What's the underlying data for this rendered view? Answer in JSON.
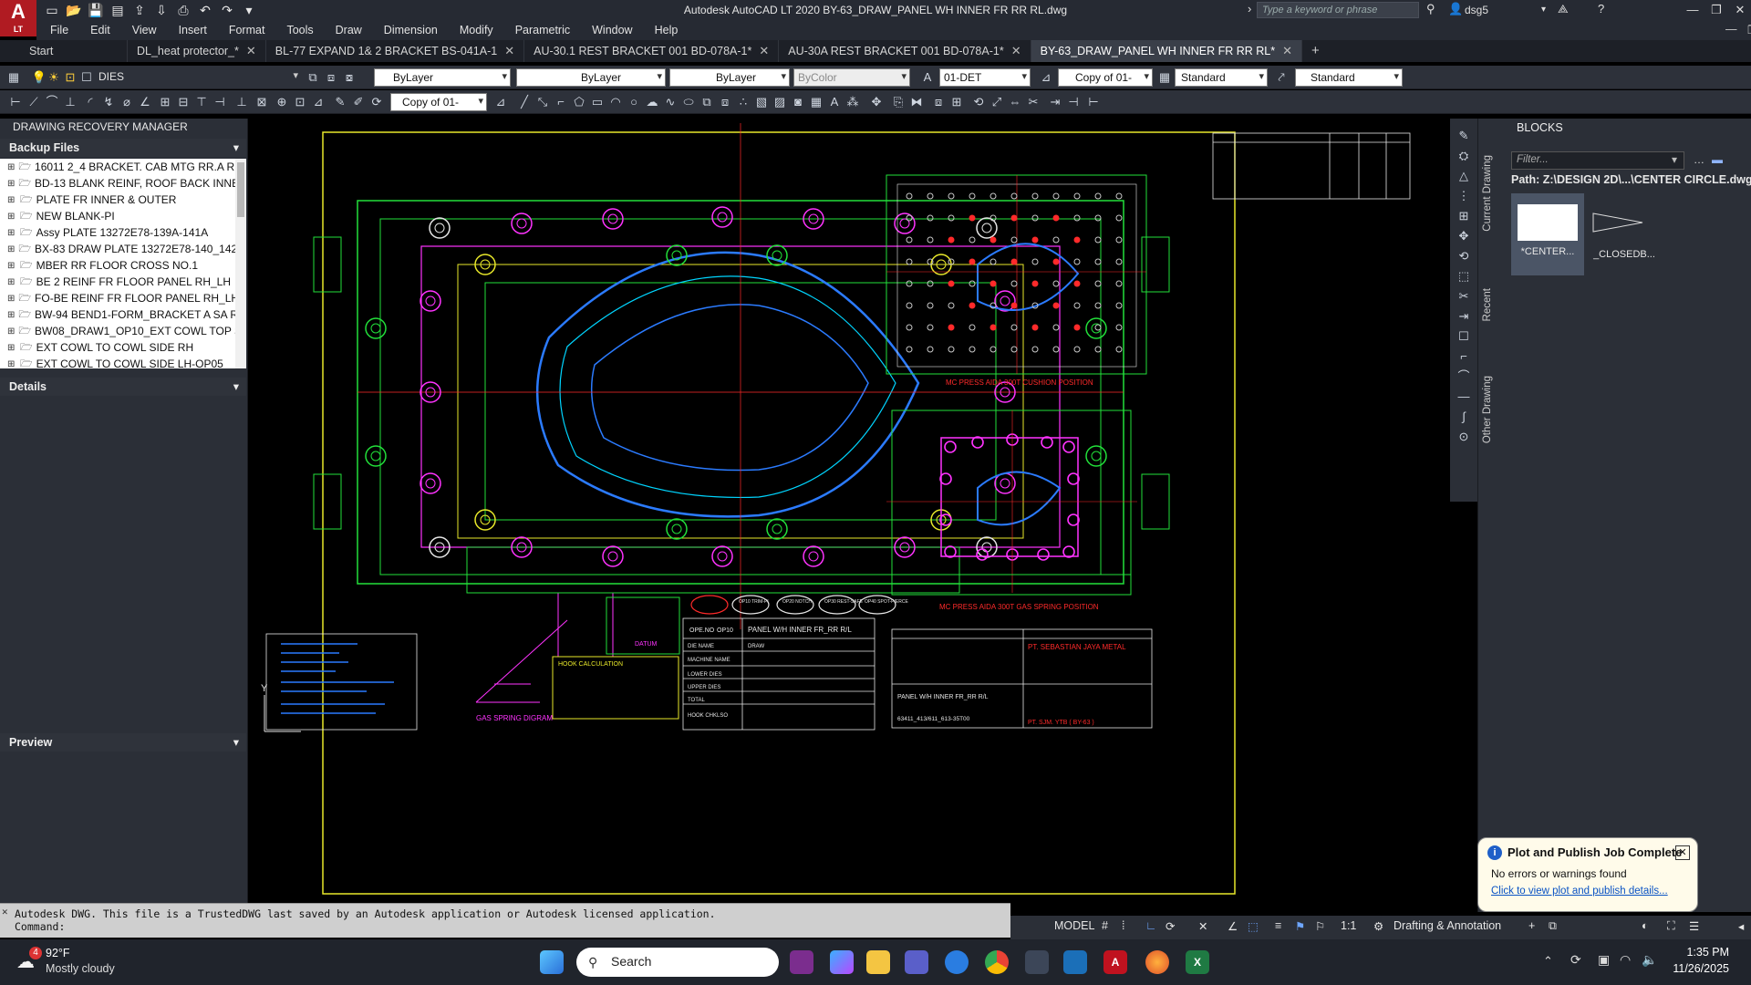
{
  "window": {
    "title": "Autodesk AutoCAD LT 2020   BY-63_DRAW_PANEL WH INNER FR RR RL.dwg",
    "search_placeholder": "Type a keyword or phrase",
    "user": "dsg5",
    "logo_letter": "A",
    "logo_sub": "LT"
  },
  "menu": [
    "File",
    "Edit",
    "View",
    "Insert",
    "Format",
    "Tools",
    "Draw",
    "Dimension",
    "Modify",
    "Parametric",
    "Window",
    "Help"
  ],
  "tabs": [
    {
      "label": "Start",
      "closable": false,
      "active": false
    },
    {
      "label": "DL_heat protector_*",
      "closable": true,
      "active": false
    },
    {
      "label": "BL-77 EXPAND 1& 2 BRACKET BS-041A-1",
      "closable": true,
      "active": false
    },
    {
      "label": "AU-30.1 REST BRACKET 001 BD-078A-1*",
      "closable": true,
      "active": false
    },
    {
      "label": "AU-30A REST BRACKET 001 BD-078A-1*",
      "closable": true,
      "active": false
    },
    {
      "label": "BY-63_DRAW_PANEL WH INNER FR RR RL*",
      "closable": true,
      "active": true
    }
  ],
  "properties_bar": {
    "layer": "DIES",
    "color": "ByLayer",
    "linetype": "ByLayer",
    "lineweight": "ByLayer",
    "plotstyle": "ByColor",
    "dimstyle": "01-DET",
    "text_style": "Copy of 01-",
    "table_style": "Standard",
    "mleader_style": "Standard",
    "dim_override": "Copy of 01-"
  },
  "left_panel": {
    "title": "DRAWING RECOVERY MANAGER",
    "backup_header": "Backup Files",
    "details_header": "Details",
    "preview_header": "Preview",
    "backup_files": [
      "16011 2_4 BRACKET. CAB MTG RR.A RH",
      "BD-13 BLANK REINF, ROOF BACK INNE",
      "PLATE FR INNER & OUTER",
      "NEW BLANK-PI",
      "Assy PLATE 13272E78-139A-141A",
      "BX-83 DRAW PLATE 13272E78-140_142",
      "MBER RR FLOOR CROSS NO.1",
      "BE 2 REINF FR FLOOR PANEL RH_LH",
      "FO-BE REINF FR FLOOR PANEL RH_LH",
      "BW-94 BEND1-FORM_BRACKET A SA RI",
      "BW08_DRAW1_OP10_EXT COWL TOP SI",
      "EXT COWL TO COWL SIDE RH",
      "EXT COWL TO COWL SIDE LH-OP05"
    ]
  },
  "blocks_panel": {
    "title": "BLOCKS",
    "filter_placeholder": "Filter...",
    "path": "Path: Z:\\DESIGN 2D\\...\\CENTER CIRCLE.dwg",
    "vtabs": [
      "Current Drawing",
      "Recent",
      "Other Drawing"
    ],
    "items": [
      "*CENTER...",
      "_CLOSEDB..."
    ]
  },
  "drawing": {
    "title_block": {
      "ope_no": "OPE.NO",
      "op": "OP10",
      "part_name": "PANEL W/H INNER FR_RR R/L",
      "die_name_label": "DIE NAME",
      "die_name": "DRAW",
      "machine_name_label": "MACHINE NAME",
      "upper_dies_label": "UPPER DIES",
      "lower_dies_label": "LOWER DIES",
      "total_label": "TOTAL",
      "hook_label": "HOOK CHKLSO",
      "company": "PT. SEBASTIAN JAYA METAL",
      "part_name_footer": "PANEL W/H INNER FR_RR R/L",
      "part_no": "63411_413/611_613-35T00",
      "ref": "PT. SJM. YTB ( BY-63 )"
    },
    "press_cushion_label": "MC PRESS AIDA 300T CUSHION POSITION",
    "press_gas_label": "MC PRESS AIDA 300T GAS SPRING POSITION",
    "ops": [
      "OP10 TRIM-PI",
      "OP20 NOTCH",
      "OP30 REST-SAFE",
      "OP40 SPOT-PIERCE"
    ],
    "gas_spring_label": "GAS SPRING DIGRAM",
    "hook_calc_title": "HOOK CALCULATION",
    "datum_label": "DATUM"
  },
  "command": {
    "history": "Autodesk DWG.  This file is a TrustedDWG last saved by an Autodesk application or Autodesk licensed application.",
    "prompt": "Command:"
  },
  "status_bar": {
    "space": "MODEL",
    "scale": "1:1",
    "workspace": "Drafting & Annotation"
  },
  "notification": {
    "title": "Plot and Publish Job Complete",
    "message": "No errors or warnings found",
    "link": "Click to view plot and publish details..."
  },
  "taskbar": {
    "temp": "92°F",
    "weather": "Mostly cloudy",
    "weather_badge": "4",
    "search": "Search",
    "time": "1:35 PM",
    "date": "11/26/2025"
  },
  "colors": {
    "titlebar": "#262a33",
    "canvas": "#000000",
    "accent_red": "#b01b22",
    "cad_green": "#22e03a",
    "cad_magenta": "#ff33ff",
    "cad_blue": "#2b7bff",
    "cad_yellow": "#e8e82a",
    "cad_red": "#ff2a2a"
  }
}
